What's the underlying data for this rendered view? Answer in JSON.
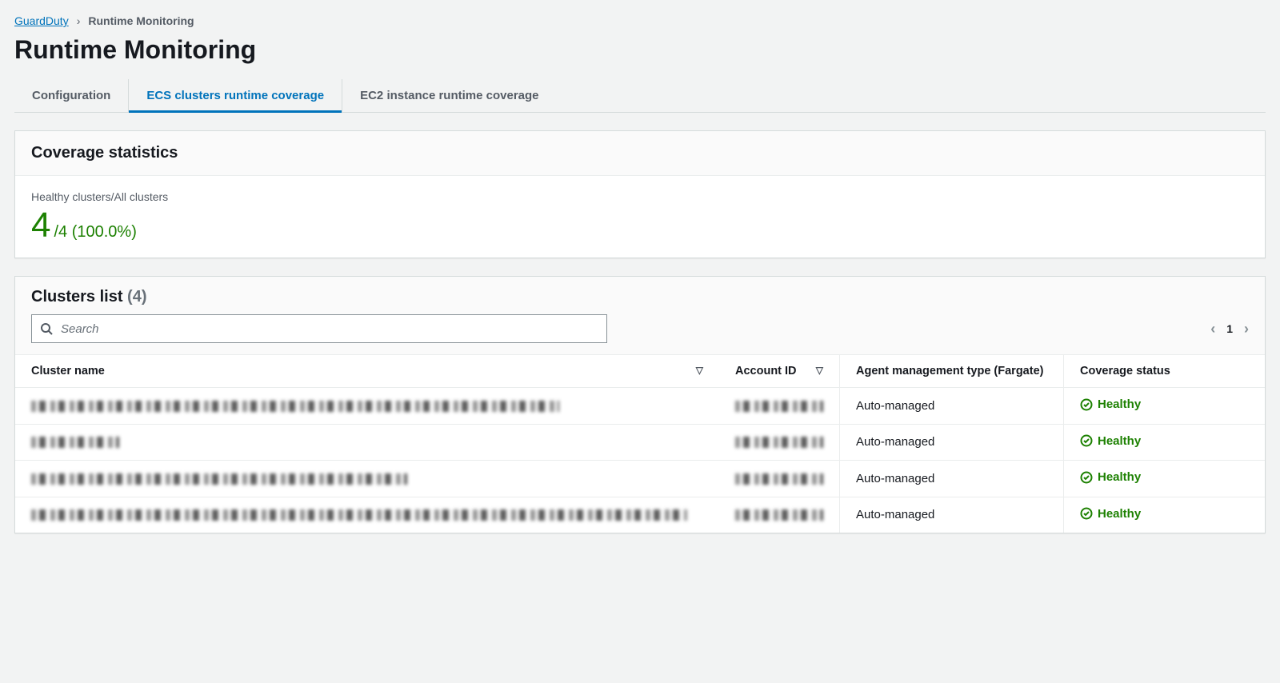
{
  "breadcrumb": {
    "root": "GuardDuty",
    "current": "Runtime Monitoring"
  },
  "page_title": "Runtime Monitoring",
  "tabs": [
    {
      "label": "Configuration"
    },
    {
      "label": "ECS clusters runtime coverage"
    },
    {
      "label": "EC2 instance runtime coverage"
    }
  ],
  "coverage": {
    "heading": "Coverage statistics",
    "label": "Healthy clusters/All clusters",
    "big": "4",
    "suffix": "/4 (100.0%)"
  },
  "clusters_list": {
    "title": "Clusters list",
    "count_label": "(4)",
    "search_placeholder": "Search",
    "page": "1",
    "columns": {
      "name": "Cluster name",
      "account": "Account ID",
      "agent": "Agent management type (Fargate)",
      "status": "Coverage status"
    },
    "rows": [
      {
        "name_w": 660,
        "acct_w": 110,
        "agent": "Auto-managed",
        "status": "Healthy"
      },
      {
        "name_w": 110,
        "acct_w": 110,
        "agent": "Auto-managed",
        "status": "Healthy"
      },
      {
        "name_w": 470,
        "acct_w": 110,
        "agent": "Auto-managed",
        "status": "Healthy"
      },
      {
        "name_w": 820,
        "acct_w": 110,
        "agent": "Auto-managed",
        "status": "Healthy"
      }
    ]
  }
}
